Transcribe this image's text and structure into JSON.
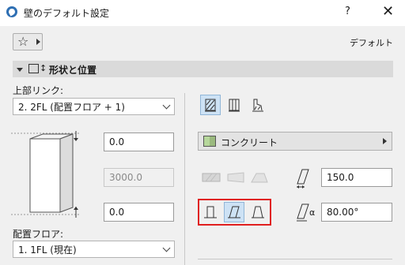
{
  "window": {
    "title": "壁のデフォルト設定",
    "help_label": "?",
    "close_label": "✕"
  },
  "favorites": {
    "star_glyph": "☆"
  },
  "header": {
    "default_label": "デフォルト"
  },
  "section": {
    "title": "形状と位置",
    "icon2": "↕"
  },
  "top_link": {
    "label": "上部リンク:",
    "value": "2. 2FL (配置フロア + 1)"
  },
  "heights": {
    "top_offset": "0.0",
    "height": "3000.0",
    "bottom_offset": "0.0"
  },
  "home_floor": {
    "label": "配置フロア:",
    "value": "1. 1FL (現在)"
  },
  "material": {
    "value": "コンクリート",
    "swatch_color": "#b6d79b"
  },
  "thickness": {
    "value": "150.0"
  },
  "angle": {
    "value": "80.00°",
    "alpha": "α"
  },
  "geometry_buttons": [
    "straight-wall",
    "slanted-wall",
    "double-slanted-wall"
  ],
  "structure_buttons": [
    "basic-structure",
    "composite-structure",
    "profile-structure"
  ],
  "selected": {
    "geometry": "slanted-wall",
    "structure": "basic-structure"
  },
  "colors": {
    "highlight_border": "#e01e1e",
    "selected_bg": "#cde2f5"
  }
}
